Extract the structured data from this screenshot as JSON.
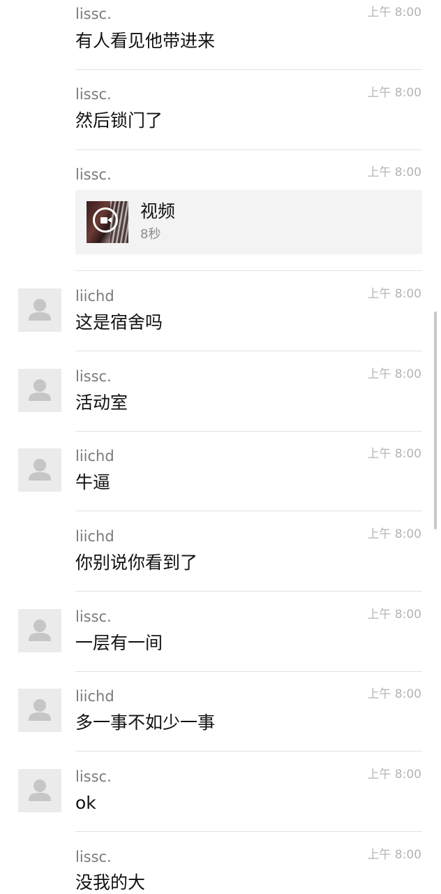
{
  "chat": {
    "messages": [
      {
        "sender": "lissc.",
        "time": "上午 8:00",
        "text": "有人看见他带进来",
        "avatar": false
      },
      {
        "sender": "lissc.",
        "time": "上午 8:00",
        "text": "然后锁门了",
        "avatar": false
      },
      {
        "sender": "lissc.",
        "time": "上午 8:00",
        "text": "",
        "avatar": false,
        "video": {
          "title": "视频",
          "duration": "8秒",
          "icon": "video-camera-icon"
        }
      },
      {
        "sender": "liichd",
        "time": "上午 8:00",
        "text": "这是宿舍吗",
        "avatar": true
      },
      {
        "sender": "lissc.",
        "time": "上午 8:00",
        "text": "活动室",
        "avatar": true
      },
      {
        "sender": "liichd",
        "time": "上午 8:00",
        "text": "牛逼",
        "avatar": true
      },
      {
        "sender": "liichd",
        "time": "上午 8:00",
        "text": "你别说你看到了",
        "avatar": false
      },
      {
        "sender": "lissc.",
        "time": "上午 8:00",
        "text": "一层有一间",
        "avatar": true
      },
      {
        "sender": "liichd",
        "time": "上午 8:00",
        "text": "多一事不如少一事",
        "avatar": true
      },
      {
        "sender": "lissc.",
        "time": "上午 8:00",
        "text": "ok",
        "avatar": true
      },
      {
        "sender": "lissc.",
        "time": "上午 8:00",
        "text": "没我的大",
        "avatar": false
      }
    ]
  },
  "colors": {
    "background": "#ffffff",
    "sender": "#7a7a7a",
    "time": "#b4b4b4",
    "text": "#111111",
    "divider": "#e2e2e2",
    "avatar_placeholder": "#ebebeb",
    "video_card": "#f3f3f3"
  }
}
